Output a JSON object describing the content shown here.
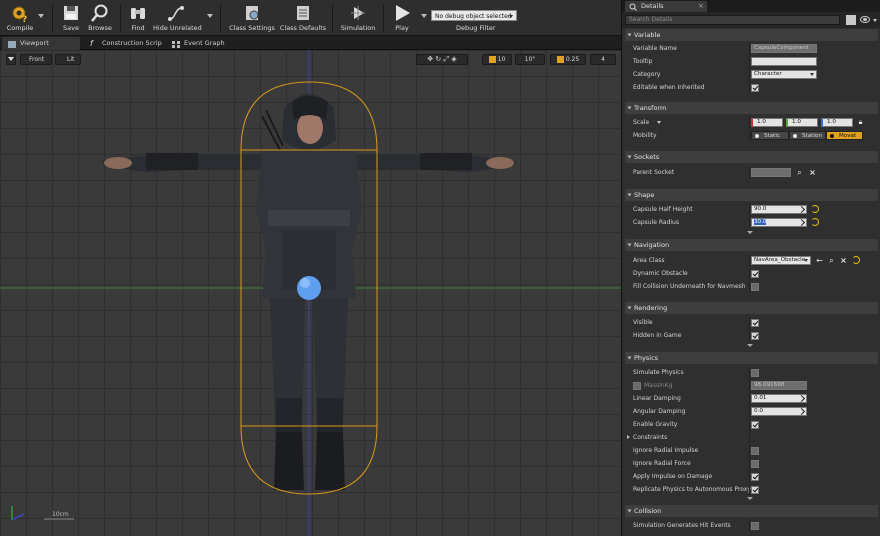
{
  "toolbar": {
    "compile": "Compile",
    "save": "Save",
    "browse": "Browse",
    "find": "Find",
    "hide_unrelated": "Hide Unrelated",
    "class_settings": "Class Settings",
    "class_defaults": "Class Defaults",
    "simulation": "Simulation",
    "play": "Play",
    "debug_object": "No debug object selected",
    "debug_filter": "Debug Filter"
  },
  "tabs": [
    {
      "label": "Viewport"
    },
    {
      "label": "Construction Scrip"
    },
    {
      "label": "Event Graph"
    }
  ],
  "viewport": {
    "view_mode": "Front",
    "lit_mode": "Lit",
    "grid_snap": "10",
    "rotation_snap": "10°",
    "scale_snap": "0.25",
    "camera_speed": "4",
    "scale_label": "10cm"
  },
  "details": {
    "tab_label": "Details",
    "close_glyph": "×",
    "search_placeholder": "Search Details",
    "categories": {
      "variable": "Variable",
      "transform": "Transform",
      "sockets": "Sockets",
      "shape": "Shape",
      "navigation": "Navigation",
      "rendering": "Rendering",
      "physics": "Physics",
      "collision": "Collision"
    },
    "variable": {
      "variable_name_label": "Variable Name",
      "variable_name_value": "CapsuleComponent",
      "tooltip_label": "Tooltip",
      "tooltip_value": "",
      "category_label": "Category",
      "category_value": "Character",
      "editable_label": "Editable when Inherited"
    },
    "transform": {
      "scale_label": "Scale",
      "scale_x": "1.0",
      "scale_y": "1.0",
      "scale_z": "1.0",
      "mobility_label": "Mobility",
      "mobility_static": "Static",
      "mobility_stationary": "Station",
      "mobility_movable": "Movat"
    },
    "sockets": {
      "parent_socket_label": "Parent Socket",
      "parent_socket_value": ""
    },
    "shape": {
      "half_height_label": "Capsule Half Height",
      "half_height_value": "90.0",
      "radius_label": "Capsule Radius",
      "radius_value": "30.0"
    },
    "navigation": {
      "area_class_label": "Area Class",
      "area_class_value": "NavArea_Obstacle",
      "dynamic_obstacle_label": "Dynamic Obstacle",
      "fill_collision_label": "Fill Collision Underneath for Navmesh"
    },
    "rendering": {
      "visible_label": "Visible",
      "hidden_in_game_label": "Hidden in Game"
    },
    "physics": {
      "simulate_label": "Simulate Physics",
      "mass_label": "MassInKg",
      "mass_value": "98.091698",
      "linear_damping_label": "Linear Damping",
      "linear_damping_value": "0.01",
      "angular_damping_label": "Angular Damping",
      "angular_damping_value": "0.0",
      "enable_gravity_label": "Enable Gravity",
      "constraints_label": "Constraints",
      "ignore_radial_impulse_label": "Ignore Radial Impulse",
      "ignore_radial_force_label": "Ignore Radial Force",
      "apply_impulse_label": "Apply Impulse on Damage",
      "replicate_label": "Replicate Physics to Autonomous Proxy"
    },
    "collision": {
      "sim_hit_events_label": "Simulation Generates Hit Events"
    }
  },
  "colors": {
    "accent_orange": "#e0a020",
    "capsule_outline": "#d99a1a",
    "axis_green": "#3aa33a",
    "axis_blue": "#3a46c8"
  }
}
